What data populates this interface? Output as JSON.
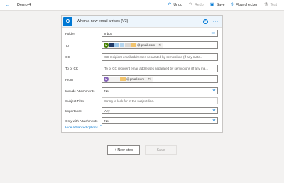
{
  "topbar": {
    "flow_name": "Demo 4",
    "undo": "Undo",
    "redo": "Redo",
    "save": "Save",
    "flow_checker": "Flow checker",
    "test": "Test"
  },
  "card": {
    "title": "When a new email arrives (V3)",
    "fields": {
      "folder": {
        "label": "Folder",
        "value": "Inbox"
      },
      "to": {
        "label": "To",
        "token_text": "@gmail.com"
      },
      "cc": {
        "label": "CC",
        "placeholder": "CC recipient email addresses separated by semicolons (If any matc..."
      },
      "to_or_cc": {
        "label": "To or CC",
        "placeholder": "To or CC recipient email addresses separated by semicolons (If any ma..."
      },
      "from": {
        "label": "From",
        "token_text": "@gmail.com"
      },
      "include_attachments": {
        "label": "Include Attachments",
        "value": "No"
      },
      "subject_filter": {
        "label": "Subject Filter",
        "placeholder": "String to look for in the subject line."
      },
      "importance": {
        "label": "Importance",
        "value": "Any"
      },
      "only_with_attachments": {
        "label": "Only with Attachments",
        "value": "No"
      }
    },
    "hide_advanced": "Hide advanced options"
  },
  "buttons": {
    "new_step": "+ New step",
    "save": "Save"
  },
  "colors": {
    "accent": "#0078d4",
    "header_bg": "#edf5fc",
    "avatar_green": "#498205",
    "avatar_purple": "#8764b8"
  },
  "icons": {
    "back": "back-arrow-icon",
    "undo": "undo-icon",
    "redo": "redo-icon",
    "save": "save-icon",
    "flow_checker": "stethoscope-icon",
    "test": "flask-icon",
    "outlook": "outlook-icon",
    "help": "help-icon",
    "more": "more-icon",
    "folder": "folder-icon",
    "dropdown": "chevron-down-icon",
    "remove": "close-icon"
  }
}
